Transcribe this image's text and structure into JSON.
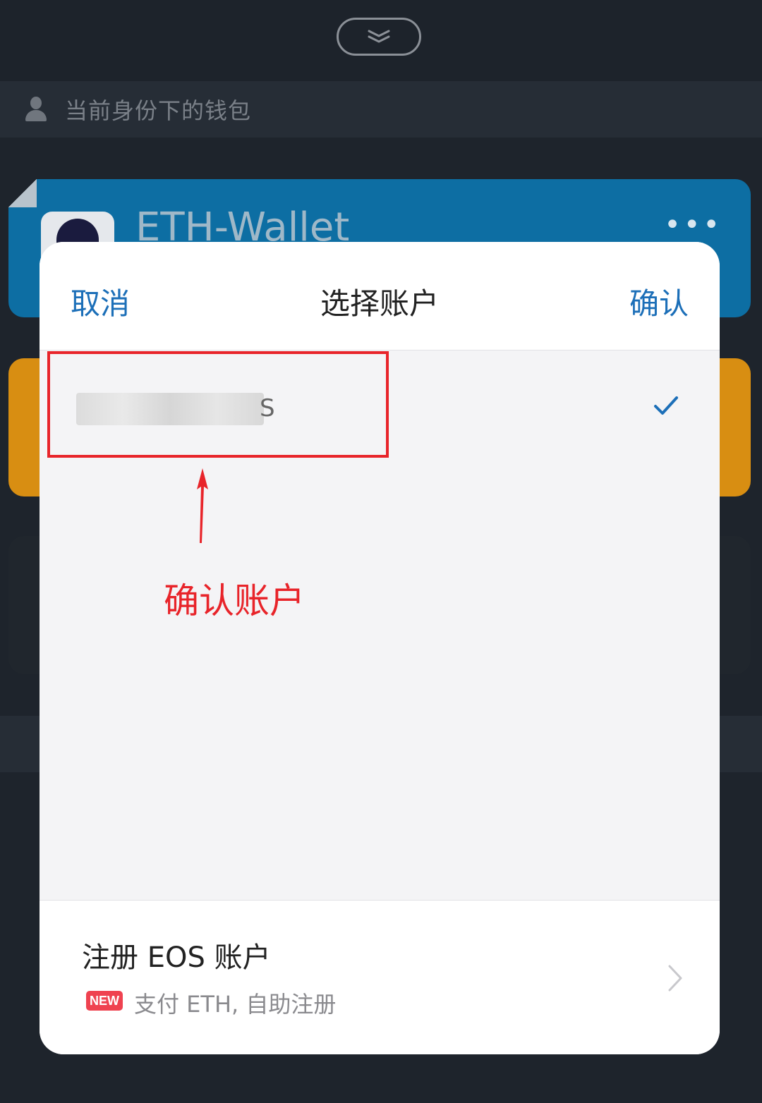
{
  "background": {
    "section_title": "当前身份下的钱包",
    "wallets": [
      {
        "name": "ETH-Wallet",
        "more": "•••"
      }
    ]
  },
  "modal": {
    "cancel_label": "取消",
    "title": "选择账户",
    "confirm_label": "确认",
    "account": {
      "name_visible_suffix": "S",
      "selected": true
    },
    "register": {
      "title": "注册 EOS 账户",
      "badge": "NEW",
      "subtitle": "支付 ETH, 自助注册"
    }
  },
  "annotation": {
    "text": "确认账户"
  },
  "colors": {
    "accent": "#1c6fb8",
    "annotation_red": "#e8242a",
    "eth_card": "#0d6ea3",
    "orange_card": "#d88e12"
  }
}
